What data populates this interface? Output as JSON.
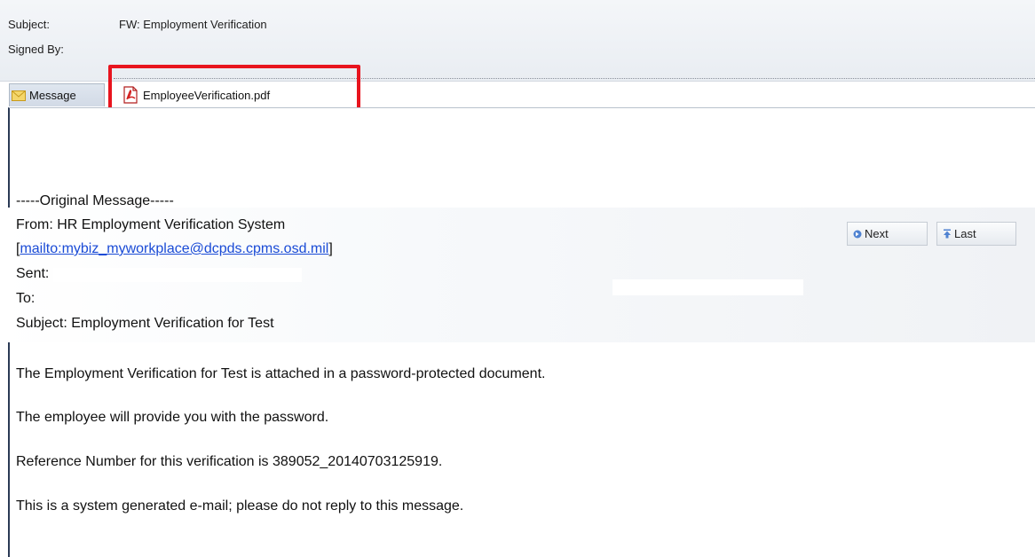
{
  "header": {
    "subject_label": "Subject:",
    "subject_value": "FW: Employment Verification",
    "signed_by_label": "Signed By:"
  },
  "tabs": {
    "message_label": "Message",
    "attachment_label": "EmployeeVerification.pdf",
    "highlight_color": "#e8141e"
  },
  "body": {
    "original_marker": "-----Original Message-----",
    "from_line": "From: HR Employment Verification System",
    "mailto_open": "[",
    "mailto_link": "mailto:mybiz_myworkplace@dcpds.cpms.osd.mil",
    "mailto_close": "]",
    "sent_label": "Sent:",
    "to_label": "To:",
    "subject_line": "Subject: Employment Verification for Test",
    "para1": "The Employment Verification for Test  is attached in a password-protected document.",
    "para2": "The employee will provide you with the password.",
    "para3": "Reference Number for this verification is 389052_20140703125919.",
    "para4": "This is a system generated e-mail; please do not reply to this message."
  },
  "nav": {
    "next_label": "Next",
    "last_label": "Last",
    "next_icon": "arrow-right-icon",
    "last_icon": "arrow-top-icon"
  }
}
